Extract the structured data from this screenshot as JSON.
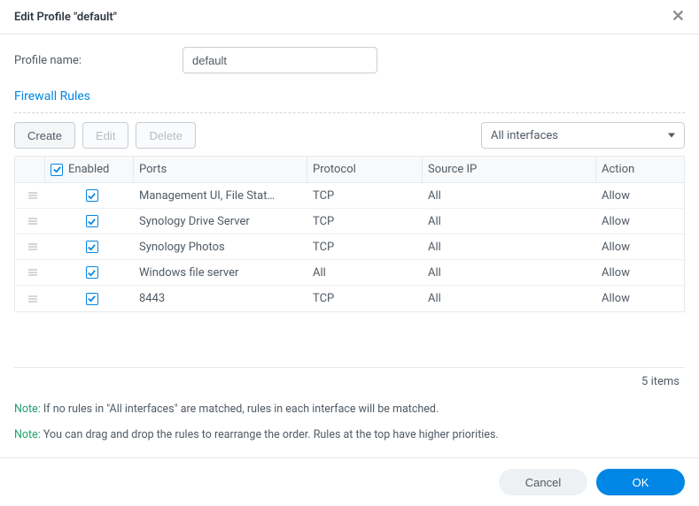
{
  "dialog": {
    "title": "Edit Profile \"default\"",
    "profile_name_label": "Profile name:",
    "profile_name_value": "default",
    "section_title": "Firewall Rules"
  },
  "toolbar": {
    "create": "Create",
    "edit": "Edit",
    "delete": "Delete",
    "interface_selected": "All interfaces"
  },
  "columns": {
    "enabled": "Enabled",
    "ports": "Ports",
    "protocol": "Protocol",
    "source_ip": "Source IP",
    "action": "Action"
  },
  "rules": [
    {
      "enabled": true,
      "ports": "Management UI, File Stat…",
      "protocol": "TCP",
      "source_ip": "All",
      "action": "Allow"
    },
    {
      "enabled": true,
      "ports": "Synology Drive Server",
      "protocol": "TCP",
      "source_ip": "All",
      "action": "Allow"
    },
    {
      "enabled": true,
      "ports": "Synology Photos",
      "protocol": "TCP",
      "source_ip": "All",
      "action": "Allow"
    },
    {
      "enabled": true,
      "ports": "Windows file server",
      "protocol": "All",
      "source_ip": "All",
      "action": "Allow"
    },
    {
      "enabled": true,
      "ports": "8443",
      "protocol": "TCP",
      "source_ip": "All",
      "action": "Allow"
    }
  ],
  "footer": {
    "item_count": "5 items"
  },
  "notes": {
    "label": "Note:",
    "line1": "If no rules in \"All interfaces\" are matched, rules in each interface will be matched.",
    "line2": "You can drag and drop the rules to rearrange the order. Rules at the top have higher priorities."
  },
  "buttons": {
    "cancel": "Cancel",
    "ok": "OK"
  }
}
